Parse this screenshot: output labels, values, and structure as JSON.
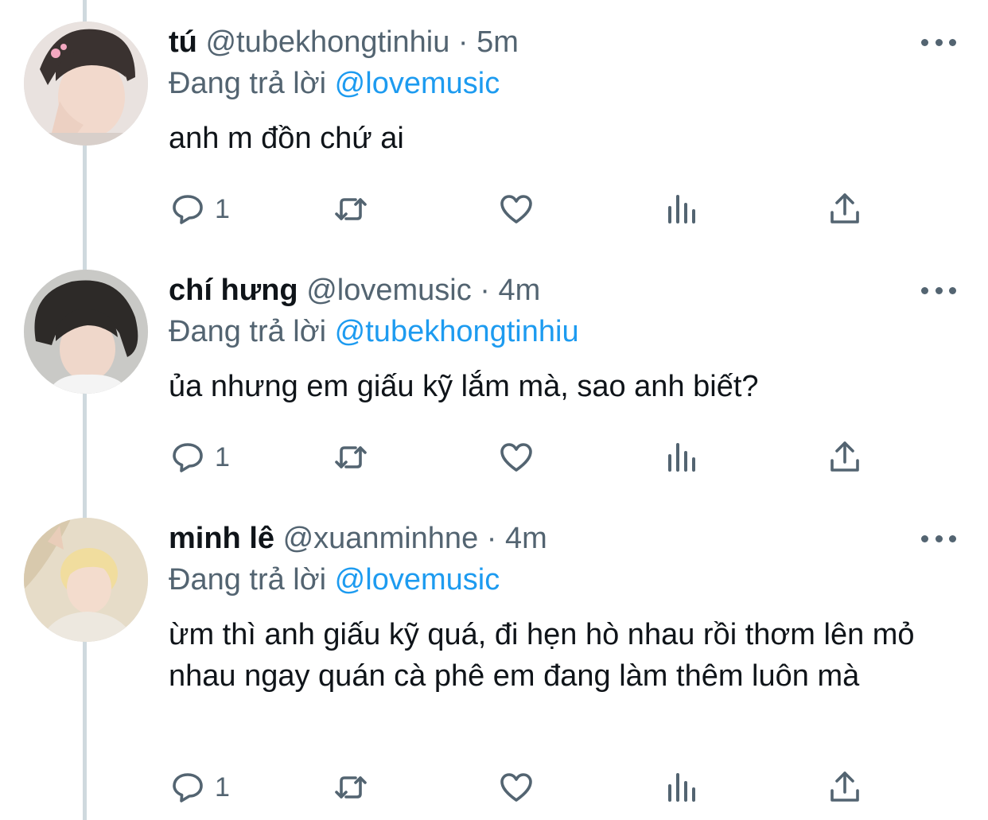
{
  "colors": {
    "accent": "#1d9bf0",
    "secondary": "#536471",
    "text": "#0f1419",
    "thread_line": "#cfd9de"
  },
  "tweets": [
    {
      "name": "tú",
      "handle": "@tubekhongtinhiu",
      "sep": "·",
      "time": "5m",
      "reply_prefix": "Đang trả lời",
      "reply_to": "@lovemusic",
      "text": "anh m đồn chứ ai",
      "reply_count": "1",
      "icons": [
        "reply-icon",
        "retweet-icon",
        "like-icon",
        "views-icon",
        "share-icon",
        "more-icon"
      ]
    },
    {
      "name": "chí hưng",
      "handle": "@lovemusic",
      "sep": "·",
      "time": "4m",
      "reply_prefix": "Đang trả lời",
      "reply_to": "@tubekhongtinhiu",
      "text": "ủa nhưng em giấu kỹ lắm mà, sao anh biết?",
      "reply_count": "1",
      "icons": [
        "reply-icon",
        "retweet-icon",
        "like-icon",
        "views-icon",
        "share-icon",
        "more-icon"
      ]
    },
    {
      "name": "minh lê",
      "handle": "@xuanminhne",
      "sep": "·",
      "time": "4m",
      "reply_prefix": "Đang trả lời",
      "reply_to": "@lovemusic",
      "text": "ừm thì anh giấu kỹ quá, đi hẹn hò nhau rồi thơm lên mỏ nhau ngay quán cà phê em đang làm thêm luôn mà",
      "reply_count": "1",
      "icons": [
        "reply-icon",
        "retweet-icon",
        "like-icon",
        "views-icon",
        "share-icon",
        "more-icon"
      ]
    }
  ]
}
